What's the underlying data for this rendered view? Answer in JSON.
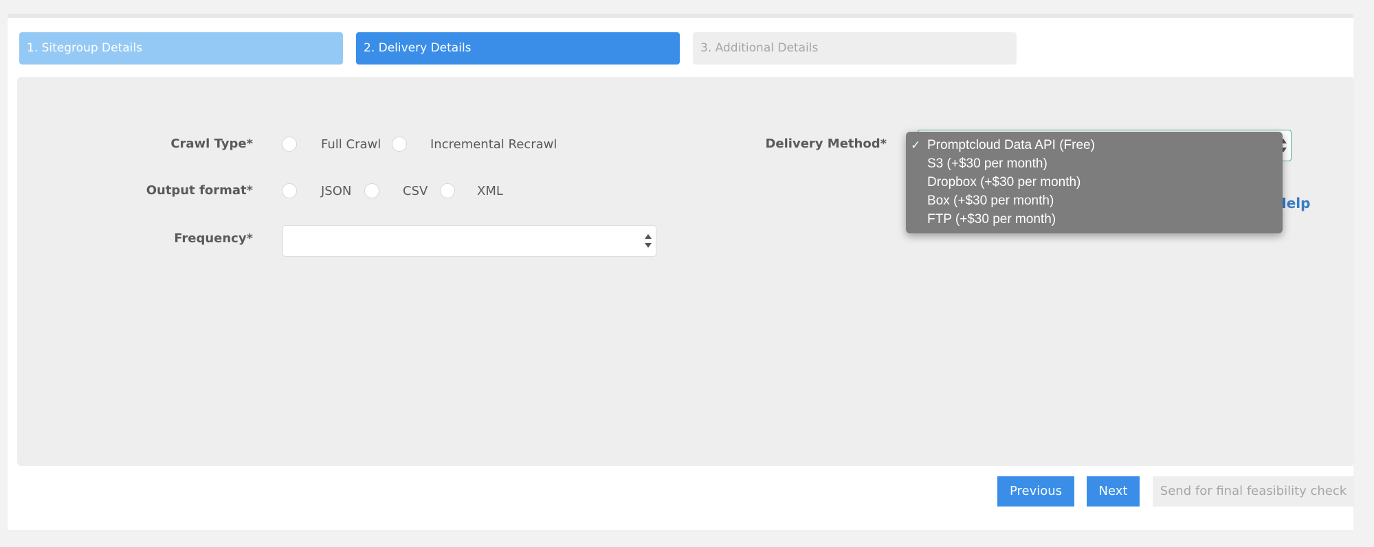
{
  "steps": [
    {
      "label": "1. Sitegroup Details",
      "state": "completed"
    },
    {
      "label": "2. Delivery Details",
      "state": "active"
    },
    {
      "label": "3. Additional Details",
      "state": "disabled"
    }
  ],
  "form": {
    "crawl_type": {
      "label": "Crawl Type*",
      "options": [
        "Full Crawl",
        "Incremental Recrawl"
      ]
    },
    "output_format": {
      "label": "Output format*",
      "options": [
        "JSON",
        "CSV",
        "XML"
      ]
    },
    "frequency": {
      "label": "Frequency*",
      "value": ""
    },
    "delivery_method": {
      "label": "Delivery Method*",
      "selected": "Promptcloud Data API (Free)",
      "options": [
        "Promptcloud Data API (Free)",
        "S3 (+$30 per month)",
        "Dropbox (+$30 per month)",
        "Box (+$30 per month)",
        "FTP (+$30 per month)"
      ],
      "check_glyph": "✓"
    },
    "help_link": "Help"
  },
  "buttons": {
    "previous": "Previous",
    "next": "Next",
    "send": "Send for final feasibility check"
  },
  "colors": {
    "primary": "#3a8ee8",
    "completed_step": "#95c9f5",
    "disabled": "#eeeeee",
    "link": "#3a7cc4",
    "focus_border": "#4cb08a"
  }
}
